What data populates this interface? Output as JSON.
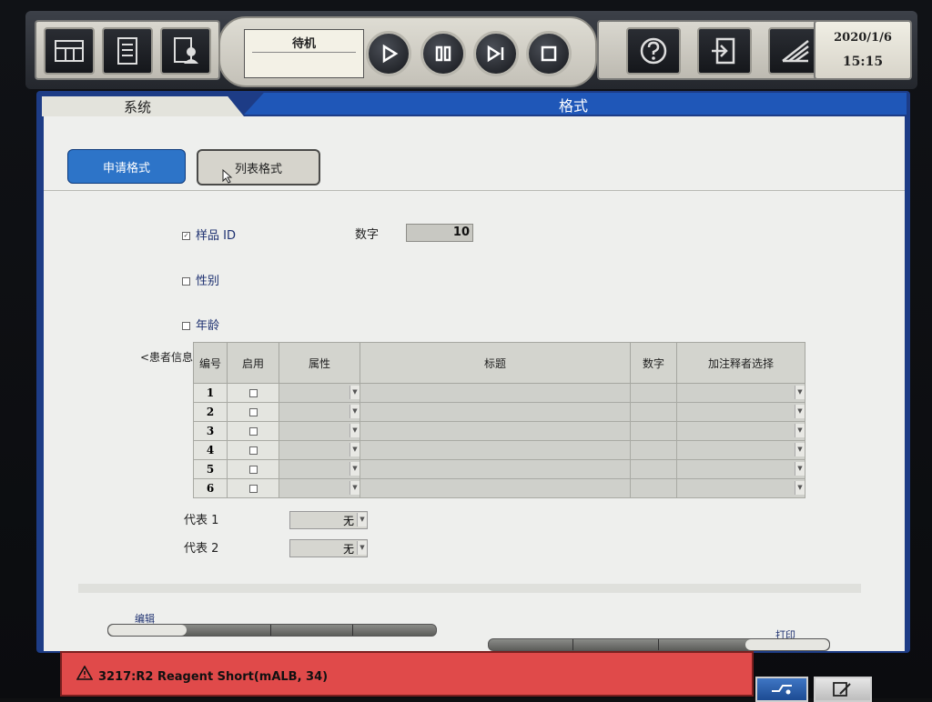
{
  "toolbar": {
    "icons_left": [
      "grid-panel-icon",
      "list-document-icon",
      "user-document-icon"
    ],
    "status_title": "待机",
    "controls": [
      "play-icon",
      "pause-icon",
      "step-forward-icon",
      "stop-icon"
    ],
    "icons_right": [
      "help-icon",
      "exit-icon",
      "maintenance-icon"
    ],
    "date": "2020/1/6",
    "time": "15:15"
  },
  "tabs": {
    "system": "系统",
    "format": "格式"
  },
  "subtabs": {
    "request_format": "申请格式",
    "list_format": "列表格式"
  },
  "fields": {
    "sample_id_label": "样品 ID",
    "sample_id_checked": true,
    "digits_label": "数字",
    "digits_value": "10",
    "sex_label": "性别",
    "sex_checked": false,
    "age_label": "年龄",
    "age_checked": false
  },
  "patient_info": {
    "section_label": "<患者信息 >",
    "columns": [
      "编号",
      "启用",
      "属性",
      "标题",
      "数字",
      "加注释者选择"
    ],
    "rows": [
      {
        "no": "1"
      },
      {
        "no": "2"
      },
      {
        "no": "3"
      },
      {
        "no": "4"
      },
      {
        "no": "5"
      },
      {
        "no": "6"
      }
    ]
  },
  "representatives": [
    {
      "label": "代表 1",
      "value": "无"
    },
    {
      "label": "代表 2",
      "value": "无"
    }
  ],
  "bottom": {
    "edit_label": "编辑",
    "print_label": "打印"
  },
  "alarm": {
    "text": "3217:R2 Reagent Short(mALB, 34)",
    "icon": "warning-triangle-icon"
  },
  "colors": {
    "panel_blue": "#1d3c86",
    "tab_blue": "#1f57b8",
    "alarm_red": "#e04a4a"
  }
}
